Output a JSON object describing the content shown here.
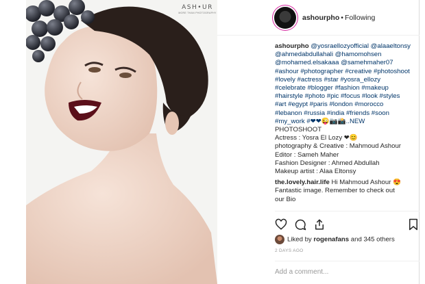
{
  "brand": {
    "name": "ASH•UR",
    "tagline": "MORE THAN PHOTOGRAPHY"
  },
  "header": {
    "username": "ashourpho",
    "separator": "•",
    "follow_status": "Following"
  },
  "caption": {
    "username": "ashourpho",
    "mentions": "@yosraellozyofficial @alaaeltonsy @ahmedabdullahali @hamomohsen @mohamed.elsakaaa @samehmaher07",
    "hashtags": "#ashour #photographer #creative #photoshoot #lovely #actress #star #yosra_ellozy #celebrate #blogger #fashion #makeup #hairstyle #photo #pic #focus #look #styles #art #egypt #paris #london #morocco #lebanon #russia #india #friends #soon #my_work",
    "emoji_tail": "#❤❤😜📷📸..NEW",
    "lines": [
      "PHOTOSHOOT",
      "Actress : Yosra El Lozy ❤😊",
      "photography & Creative : Mahmoud Ashour",
      "Editor : Sameh Maher",
      "Fashion Designer : Ahmed Abdullah",
      "Makeup artist : Alaa Eltonsy"
    ]
  },
  "comment": {
    "username": "the.lovely.hair.life",
    "text": "Hi Mahmoud Ashour 😍 Fantastic image. Remember to check out our Bio"
  },
  "likes": {
    "text": "Liked by ",
    "user": "rogenafans",
    "rest": " and 345 others"
  },
  "timeago": "2 DAYS AGO",
  "add_comment": {
    "placeholder": "Add a comment..."
  },
  "icons": [
    "heart-icon",
    "comment-icon",
    "share-icon",
    "bookmark-icon"
  ],
  "colors": {
    "link": "#003569",
    "muted": "#999999",
    "border": "#dbdbdb",
    "story_ring": "#d6249f"
  }
}
